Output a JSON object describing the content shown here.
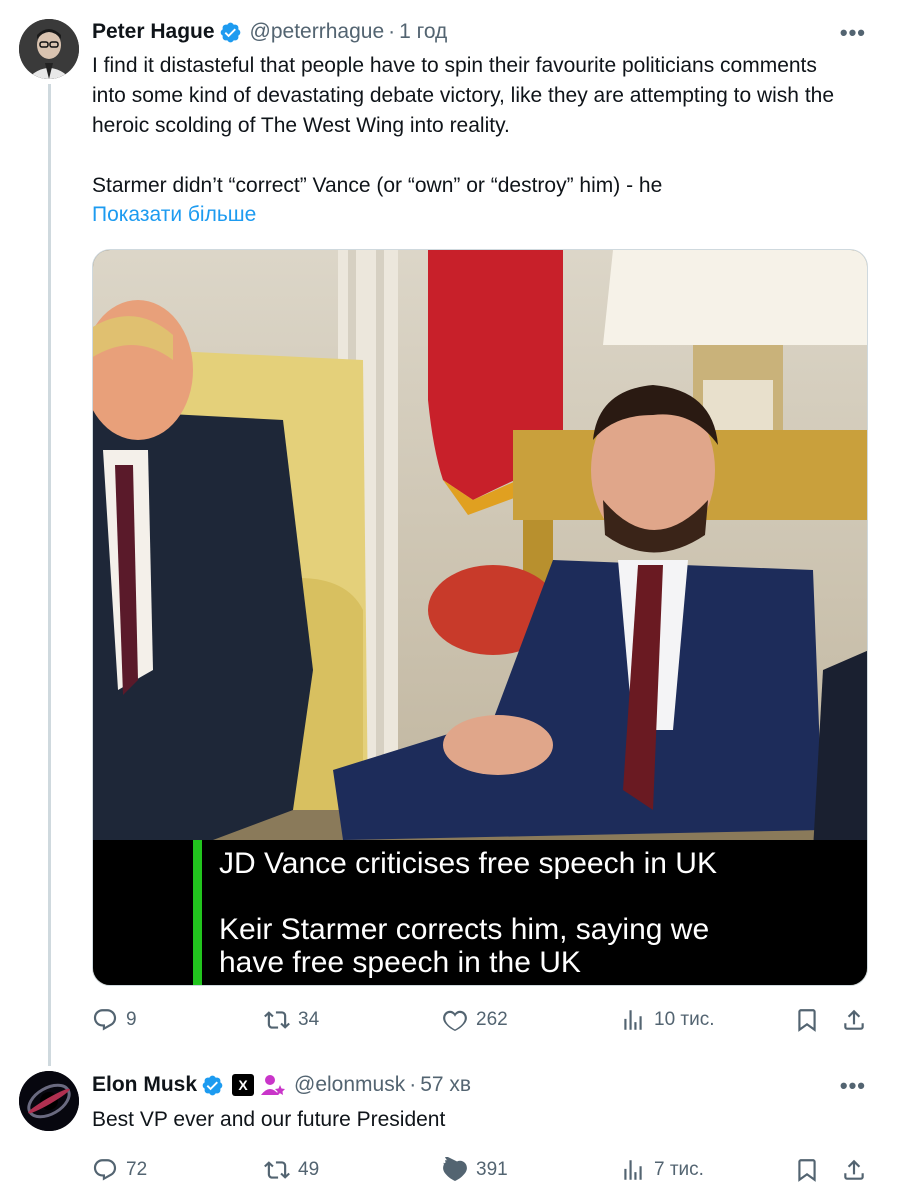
{
  "colors": {
    "accent": "#1d9bf0",
    "secondary_text": "#536471",
    "caption_bar": "#22c51e"
  },
  "tweet1": {
    "author_name": "Peter Hague",
    "handle": "@peterrhague",
    "time": "1 год",
    "separator": "·",
    "more_icon": "more-dots-icon",
    "text_p1": "I find it distasteful that people have to spin their favourite politicians comments into some kind of devastating debate victory, like they are attempting to wish the heroic scolding of The West Wing into reality.",
    "text_p2": "Starmer didn’t “correct” Vance (or “own” or “destroy” him) - he",
    "show_more": "Показати більше",
    "media": {
      "caption_line1": "JD Vance criticises free speech in UK",
      "caption_line2": "Keir Starmer corrects him, saying we",
      "caption_line3": "have free speech in the UK"
    },
    "actions": {
      "replies": "9",
      "reposts": "34",
      "likes": "262",
      "views": "10 тис."
    }
  },
  "tweet2": {
    "author_name": "Elon Musk",
    "handle": "@elonmusk",
    "time": "57 хв",
    "separator": "·",
    "affiliate_badge": "X",
    "text": "Best VP ever and our future President",
    "actions": {
      "replies": "72",
      "reposts": "49",
      "likes": "391",
      "views": "7 тис."
    }
  }
}
